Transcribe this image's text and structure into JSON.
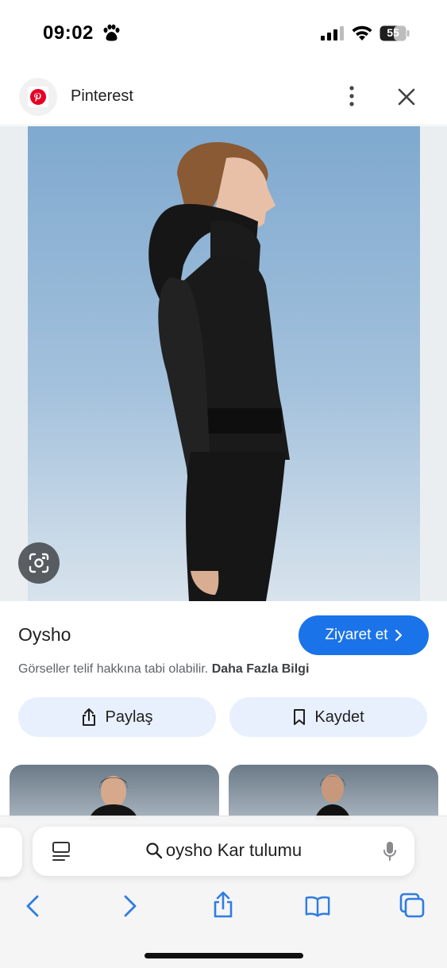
{
  "status": {
    "time": "09:02",
    "battery": "55"
  },
  "header": {
    "site_name": "Pinterest"
  },
  "result": {
    "brand": "Oysho",
    "visit_label": "Ziyaret et",
    "copyright_text": "Görseller telif hakkına tabi olabilir.",
    "copyright_link": "Daha Fazla Bilgi",
    "share_label": "Paylaş",
    "save_label": "Kaydet"
  },
  "browser": {
    "query": "oysho Kar tulumu"
  },
  "colors": {
    "accent": "#1a73e8",
    "chip_bg": "#e8f0fe",
    "pinterest_red": "#e60023"
  },
  "icons": [
    "paw-icon",
    "signal-icon",
    "wifi-icon",
    "battery-icon",
    "pinterest-logo",
    "more-vert-icon",
    "close-icon",
    "lens-icon",
    "chevron-right-icon",
    "share-icon",
    "bookmark-icon",
    "reader-icon",
    "search-icon",
    "mic-icon",
    "back-icon",
    "forward-icon",
    "bookmarks-icon",
    "tabs-icon"
  ]
}
